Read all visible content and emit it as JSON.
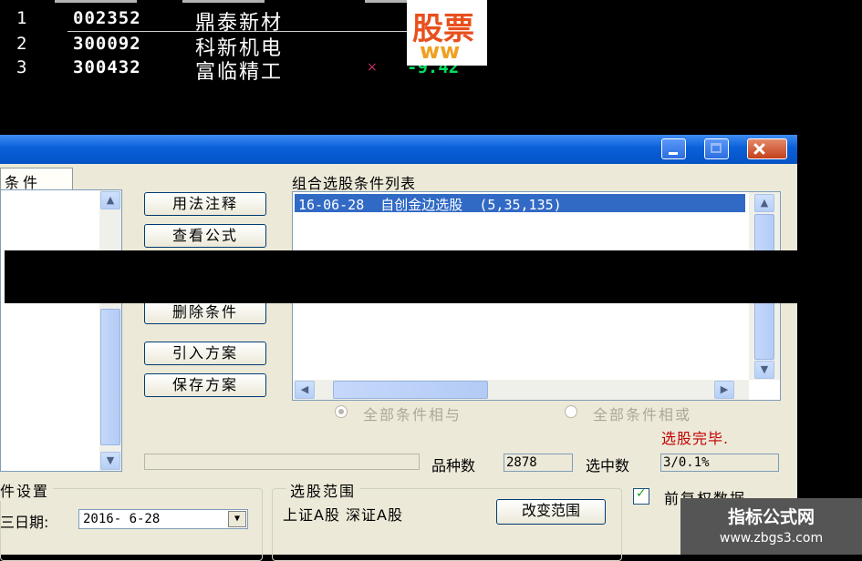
{
  "stock_list": {
    "rows": [
      {
        "index": "1",
        "code": "002352",
        "name": "鼎泰新材",
        "mark": "",
        "value": ""
      },
      {
        "index": "2",
        "code": "300092",
        "name": "科新机电",
        "mark": "",
        "value": ""
      },
      {
        "index": "3",
        "code": "300432",
        "name": "富临精工",
        "mark": "×",
        "value": "-9.42"
      }
    ]
  },
  "overlay_logo": {
    "line1": "股票",
    "line2": "ww"
  },
  "dialog": {
    "left_tab_label": "条件",
    "buttons": {
      "usage_notes": "用法注释",
      "view_formula": "查看公式",
      "delete_condition": "删除条件",
      "import_scheme": "引入方案",
      "save_scheme": "保存方案"
    },
    "condition_list_title": "组合选股条件列表",
    "condition_items": [
      "16-06-28  自创金边选股  (5,35,135)"
    ],
    "radio_and": "全部条件相与",
    "radio_or": "全部条件相或",
    "status_text": "选股完毕.",
    "count_label": "品种数",
    "count_value": "2878",
    "selected_label": "选中数",
    "selected_value": "3/0.1%",
    "condition_settings_title": "件设置",
    "date_label": "三日期:",
    "date_value": "2016- 6-28",
    "range_group_title": "选股范围",
    "range_text": "上证A股 深证A股",
    "change_range_button": "改变范围",
    "pre_download_label": "前复权数据",
    "pre_download_checked": true
  },
  "watermark": {
    "title": "指标公式网",
    "url": "www.zbgs3.com"
  }
}
